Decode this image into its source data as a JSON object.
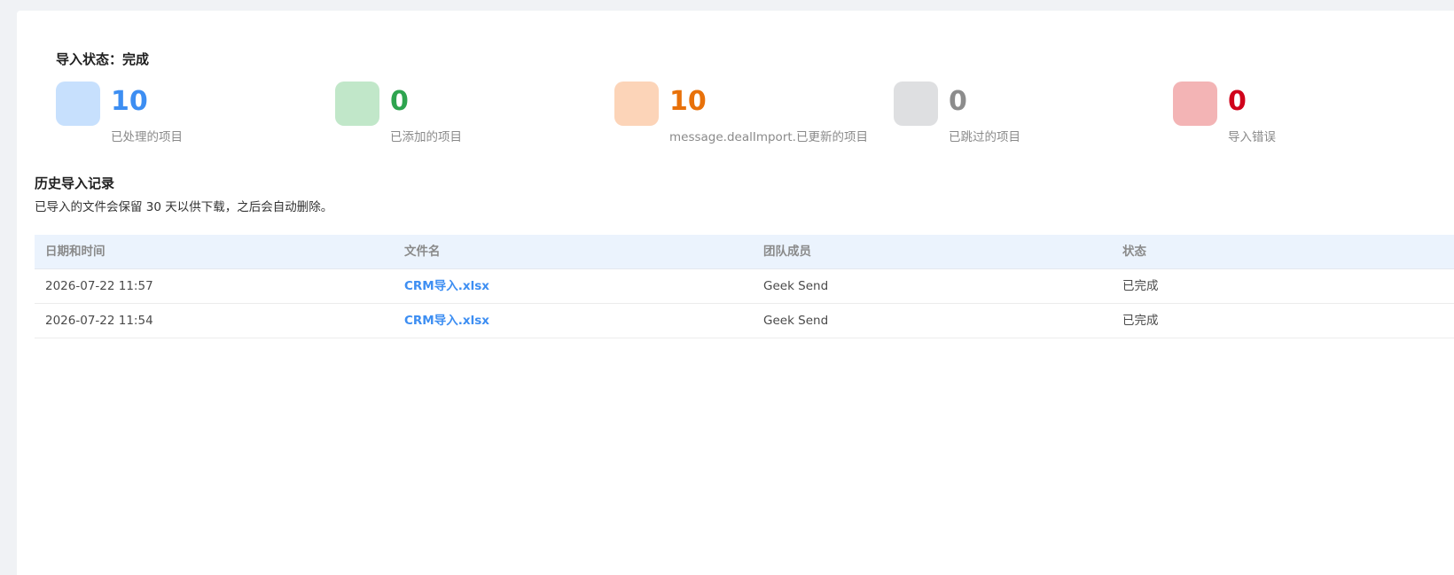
{
  "import_status": {
    "text": "导入状态：完成"
  },
  "stats": [
    {
      "value": "10",
      "label": "已处理的项目",
      "color": "#3d8ef2",
      "icon_bg": "#c7e0fd",
      "icon": "processed-icon"
    },
    {
      "value": "0",
      "label": "已添加的项目",
      "color": "#2ea44f",
      "icon_bg": "#c1e7c9",
      "icon": "added-icon"
    },
    {
      "value": "10",
      "label": "message.dealImport.已更新的项目",
      "color": "#e8710a",
      "icon_bg": "#fcd4b8",
      "icon": "updated-icon"
    },
    {
      "value": "0",
      "label": "已跳过的项目",
      "color": "#8c8c8c",
      "icon_bg": "#dedfe1",
      "icon": "skipped-icon"
    },
    {
      "value": "0",
      "label": "导入错误",
      "color": "#d0021b",
      "icon_bg": "#f3b4b5",
      "icon": "error-icon"
    }
  ],
  "history": {
    "title": "历史导入记录",
    "description": "已导入的文件会保留 30 天以供下载，之后会自动删除。",
    "columns": [
      "日期和时间",
      "文件名",
      "团队成员",
      "状态"
    ],
    "rows": [
      {
        "datetime": "2026-07-22 11:57",
        "filename": "CRM导入.xlsx",
        "member": "Geek Send",
        "status": "已完成"
      },
      {
        "datetime": "2026-07-22 11:54",
        "filename": "CRM导入.xlsx",
        "member": "Geek Send",
        "status": "已完成"
      }
    ]
  }
}
